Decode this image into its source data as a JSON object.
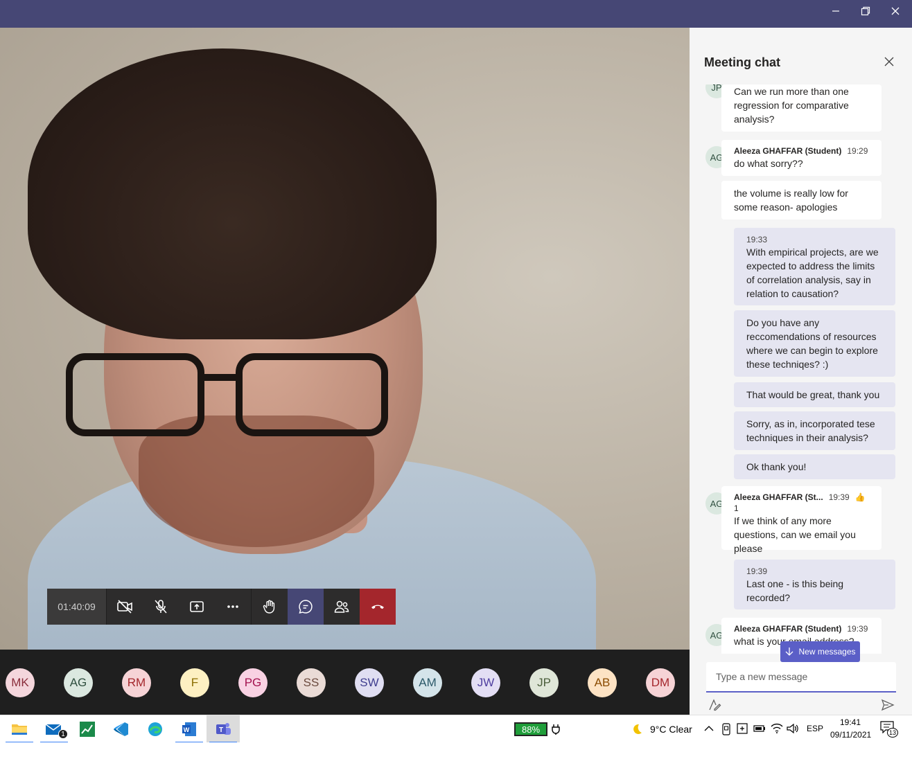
{
  "window": {
    "controls": {
      "minimize": "—",
      "restore": "❐",
      "close": "✕"
    }
  },
  "call": {
    "timer": "01:40:09"
  },
  "chat": {
    "title": "Meeting chat",
    "messages": [
      {
        "avatar": "JP",
        "text": "Can we run more than one regression for comparative analysis?"
      },
      {
        "avatar": "AG",
        "sender": "Aleeza GHAFFAR (Student)",
        "time": "19:29",
        "text": "do what sorry??"
      },
      {
        "text": "the volume is really low for some reason- apologies"
      },
      {
        "time": "19:33",
        "text": "With empirical projects, are we expected to address the limits of correlation analysis, say in relation to causation?"
      },
      {
        "text": "Do you have any reccomendations of resources where we can begin to explore these techniqes? :)"
      },
      {
        "text": "That would be great, thank you"
      },
      {
        "text": "Sorry, as in, incorporated tese techniques in their analysis?"
      },
      {
        "text": "Ok thank you!"
      },
      {
        "avatar": "AG",
        "sender": "Aleeza GHAFFAR (St...",
        "time": "19:39",
        "reaction": "👍 1",
        "text": "If we think of any more questions, can we email you please"
      },
      {
        "time": "19:39",
        "text": "Last one - is this being recorded?"
      },
      {
        "avatar": "AG",
        "sender": "Aleeza GHAFFAR (Student)",
        "time": "19:39",
        "text": "what is your email address?"
      }
    ],
    "new_messages_label": "New messages",
    "compose_placeholder": "Type a new message"
  },
  "participants": [
    {
      "initials": "MK",
      "bg": "#f4d6dc",
      "fg": "#8a2d3b"
    },
    {
      "initials": "AG",
      "bg": "#dbe8e0",
      "fg": "#2f4f3f"
    },
    {
      "initials": "RM",
      "bg": "#f6d3d6",
      "fg": "#a4262c"
    },
    {
      "initials": "F",
      "bg": "#fdf0c2",
      "fg": "#8a6d00"
    },
    {
      "initials": "PG",
      "bg": "#f9d2e3",
      "fg": "#a3124f"
    },
    {
      "initials": "SS",
      "bg": "#eadbd6",
      "fg": "#6b4a3e"
    },
    {
      "initials": "SW",
      "bg": "#e0def2",
      "fg": "#3f3d8f"
    },
    {
      "initials": "AM",
      "bg": "#d4e4ea",
      "fg": "#2b5969"
    },
    {
      "initials": "JW",
      "bg": "#e3def4",
      "fg": "#4f3fa0"
    },
    {
      "initials": "JP",
      "bg": "#dfe6d8",
      "fg": "#4a5d3a"
    },
    {
      "initials": "AB",
      "bg": "#fde3c4",
      "fg": "#8a4b00"
    },
    {
      "initials": "DM",
      "bg": "#f6d3d6",
      "fg": "#a4262c"
    }
  ],
  "taskbar": {
    "battery": "88%",
    "weather": "9°C  Clear",
    "language": "ESP",
    "time": "19:41",
    "date": "09/11/2021",
    "mail_badge": "1",
    "notification_badge": "13"
  },
  "colors": {
    "teams_purple": "#464775",
    "accent": "#5b5fc7",
    "hangup": "#a4262c"
  }
}
